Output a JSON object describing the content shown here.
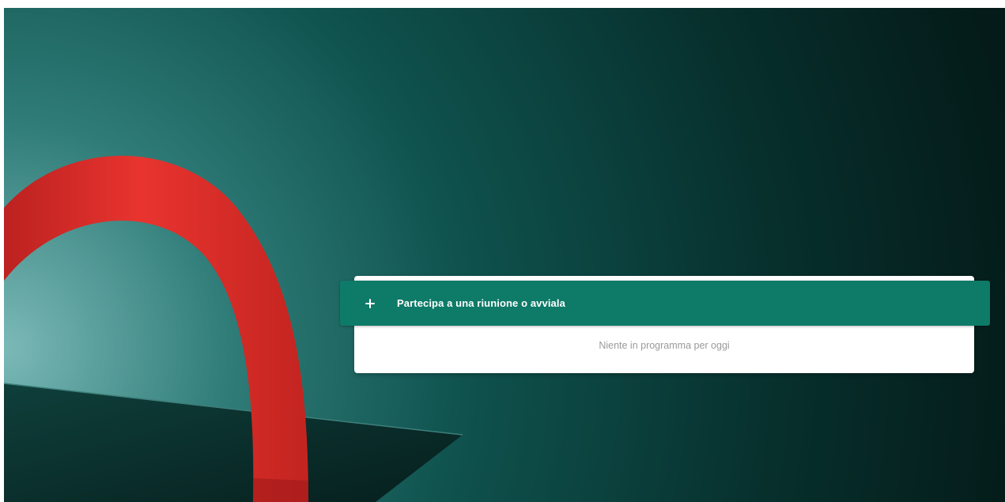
{
  "app": {
    "background": {
      "description_colors": {
        "teal_light": "#5ea8a6",
        "teal_mid": "#0f5a55",
        "teal_dark": "#062624",
        "ring": "#e5332e",
        "ring_shadow": "#a71c1c",
        "table_top": "#0c3835"
      }
    }
  },
  "meetings": {
    "join_button": {
      "label": "Partecipa a una riunione o avviala",
      "icon": "plus-icon",
      "color": "#0e7a68"
    },
    "empty_state": {
      "text": "Niente in programma per oggi"
    }
  }
}
